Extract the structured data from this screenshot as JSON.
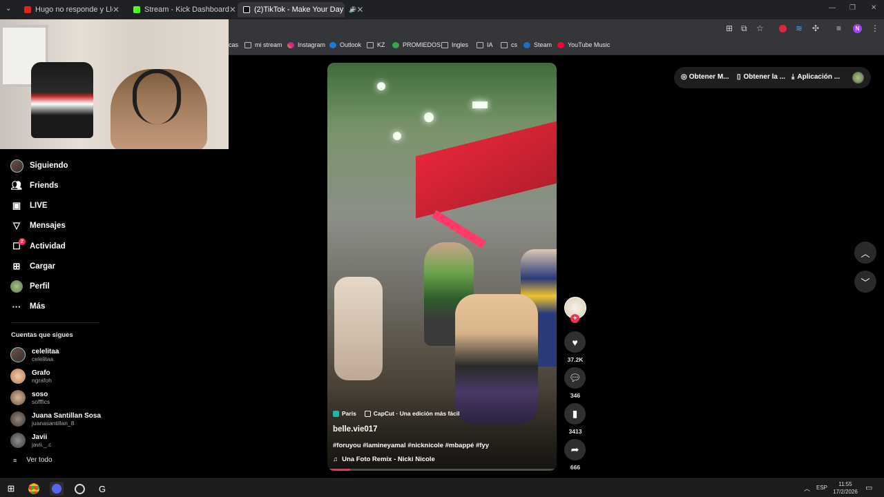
{
  "browser": {
    "tabs": [
      {
        "title": "Hugo no responde y Llega Santi",
        "color": "#e62117"
      },
      {
        "title": "Stream - Kick Dashboard",
        "color": "#53fc18"
      },
      {
        "title": "(2)TikTok - Make Your Day",
        "color": "#ffffff"
      }
    ],
    "new_tab": "+",
    "bookmarks": [
      {
        "label": "cas"
      },
      {
        "label": "mi stream"
      },
      {
        "label": "Instagram"
      },
      {
        "label": "Outlook"
      },
      {
        "label": "KZ"
      },
      {
        "label": "PROMIEDOS"
      },
      {
        "label": "Ingles"
      },
      {
        "label": "IA"
      },
      {
        "label": "cs"
      },
      {
        "label": "Steam"
      },
      {
        "label": "YouTube Music"
      }
    ],
    "profile_initial": "N"
  },
  "sidebar": {
    "nav": [
      {
        "label": "Siguiendo",
        "icon": "following-avatar-icon"
      },
      {
        "label": "Friends",
        "icon": "friends-icon"
      },
      {
        "label": "LIVE",
        "icon": "live-icon"
      },
      {
        "label": "Mensajes",
        "icon": "messages-icon"
      },
      {
        "label": "Actividad",
        "icon": "activity-icon",
        "badge": "2"
      },
      {
        "label": "Cargar",
        "icon": "upload-icon"
      },
      {
        "label": "Perfil",
        "icon": "profile-avatar-icon"
      },
      {
        "label": "Más",
        "icon": "more-icon"
      }
    ],
    "following_title": "Cuentas que sigues",
    "accounts": [
      {
        "name": "celelitaa",
        "handle": "celelitaa"
      },
      {
        "name": "Grafo",
        "handle": "ngrafoh"
      },
      {
        "name": "soso",
        "handle": "sofffics"
      },
      {
        "name": "Juana Santillan Sosa",
        "handle": "juanasantillan_8"
      },
      {
        "name": "Javii",
        "handle": "javii._.c"
      }
    ],
    "see_all": "Ver todo"
  },
  "video": {
    "location": "París",
    "capcut": "CapCut · Una edición más fácil",
    "author": "belle.vie017",
    "hashtags": "#foruyou #lamineyamal #nicknicole #mbappé #fyy",
    "sound": "Una Foto Remix - Nicki Nicole",
    "progress_percent": 10
  },
  "actions": {
    "likes": "37.2K",
    "comments": "346",
    "saves": "3413",
    "shares": "666",
    "follow": "+"
  },
  "top_bar": {
    "get_coins": "Obtener M...",
    "get_app": "Obtener la ...",
    "desktop_app": "Aplicación ..."
  },
  "taskbar": {
    "language": "ESP",
    "time": "11:55",
    "date": "17/2/2026"
  },
  "colors": {
    "accent": "#fe2c55",
    "background": "#000000"
  }
}
